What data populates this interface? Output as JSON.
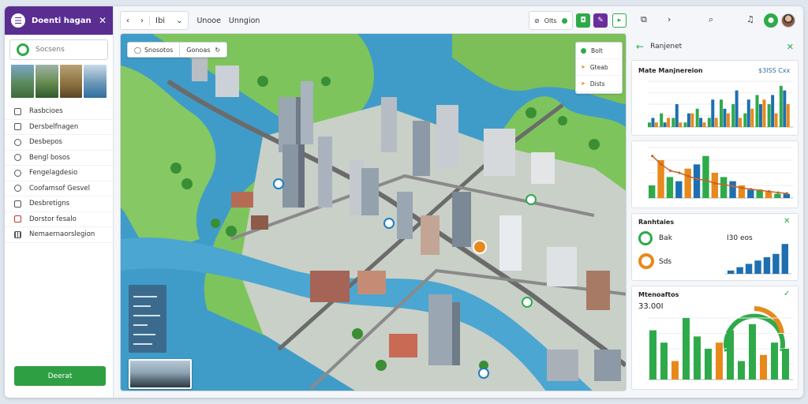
{
  "sidebar": {
    "title": "Doenti hagan",
    "search_placeholder": "Socsens",
    "items": [
      {
        "label": "Rasbcioes",
        "icon": "layers-icon"
      },
      {
        "label": "Dersbelfnagen",
        "icon": "list-icon"
      },
      {
        "label": "Desbepos",
        "icon": "circle-icon"
      },
      {
        "label": "Bengl bosos",
        "icon": "info-icon"
      },
      {
        "label": "Fengelagdesio",
        "icon": "gear-icon"
      },
      {
        "label": "Coofamsof Gesvel",
        "icon": "target-icon"
      },
      {
        "label": "Desbretigns",
        "icon": "pin-icon"
      },
      {
        "label": "Dorstor fesalo",
        "icon": "warning-icon"
      },
      {
        "label": "Nemaernaorslegion",
        "icon": "grid-icon"
      }
    ],
    "bottom_button": "Deerat"
  },
  "toolbar": {
    "back": "‹",
    "forward": "›",
    "tab_label": "Ibi",
    "dropdown": "⌄",
    "title": "Unooe",
    "subtitle": "Unngion",
    "pill_label": "Olts",
    "colors": {
      "green": "#2eaa4a",
      "purple": "#6a2d9a"
    }
  },
  "map": {
    "search_a": "Snosotos",
    "search_b": "Gonoas",
    "panel_items": [
      "Bolt",
      "Gteab",
      "Dists"
    ]
  },
  "rpanel": {
    "header_title": "Ranjenet",
    "card1": {
      "title": "Mate Manjnereion",
      "value": "$3ISS Cxx"
    },
    "card3": {
      "title": "Ranhtaies",
      "gauge1_label": "Bak",
      "gauge2_label": "Sds",
      "value": "I30 eos"
    },
    "card4": {
      "title": "Mtenoaftos",
      "value": "33.00I"
    }
  },
  "chart_data": [
    {
      "type": "bar",
      "series": [
        {
          "values": [
            1,
            3,
            2,
            1,
            4,
            2,
            6,
            5,
            3,
            7,
            5,
            9
          ]
        },
        {
          "values": [
            2,
            1,
            5,
            3,
            2,
            6,
            4,
            8,
            6,
            5,
            7,
            8
          ]
        },
        {
          "values": [
            1,
            2,
            1,
            3,
            1,
            2,
            3,
            2,
            4,
            6,
            3,
            5
          ]
        }
      ],
      "ylim": [
        0,
        10
      ]
    },
    {
      "type": "bar",
      "values": [
        3,
        9,
        5,
        4,
        7,
        8,
        10,
        6,
        5,
        4,
        3,
        2,
        2,
        1.5,
        1,
        1
      ],
      "line": [
        10,
        8,
        6.5,
        6,
        5.2,
        4.5,
        4.2,
        3.5,
        3.2,
        2.8,
        2.4,
        2.1,
        1.8,
        1.6,
        1.3,
        1.1
      ],
      "ylim": [
        0,
        12
      ]
    },
    {
      "type": "bar",
      "values": [
        1,
        2,
        3,
        4,
        5,
        6,
        9
      ],
      "ylim": [
        0,
        10
      ]
    },
    {
      "type": "bar",
      "values": [
        8,
        6,
        3,
        10,
        7,
        5,
        6,
        8,
        3,
        9,
        4,
        6,
        5
      ],
      "ylim": [
        0,
        10
      ]
    }
  ]
}
